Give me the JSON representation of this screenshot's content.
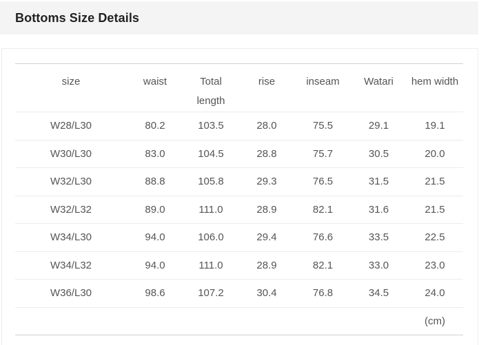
{
  "header": {
    "title": "Bottoms Size Details"
  },
  "table": {
    "columns": [
      "size",
      "waist",
      "Total length",
      "rise",
      "inseam",
      "Watari",
      "hem width"
    ],
    "rows": [
      [
        "W28/L30",
        "80.2",
        "103.5",
        "28.0",
        "75.5",
        "29.1",
        "19.1"
      ],
      [
        "W30/L30",
        "83.0",
        "104.5",
        "28.8",
        "75.7",
        "30.5",
        "20.0"
      ],
      [
        "W32/L30",
        "88.8",
        "105.8",
        "29.3",
        "76.5",
        "31.5",
        "21.5"
      ],
      [
        "W32/L32",
        "89.0",
        "111.0",
        "28.9",
        "82.1",
        "31.6",
        "21.5"
      ],
      [
        "W34/L30",
        "94.0",
        "106.0",
        "29.4",
        "76.6",
        "33.5",
        "22.5"
      ],
      [
        "W34/L32",
        "94.0",
        "111.0",
        "28.9",
        "82.1",
        "33.0",
        "23.0"
      ],
      [
        "W36/L30",
        "98.6",
        "107.2",
        "30.4",
        "76.8",
        "34.5",
        "24.0"
      ]
    ],
    "unit": "(cm)"
  }
}
